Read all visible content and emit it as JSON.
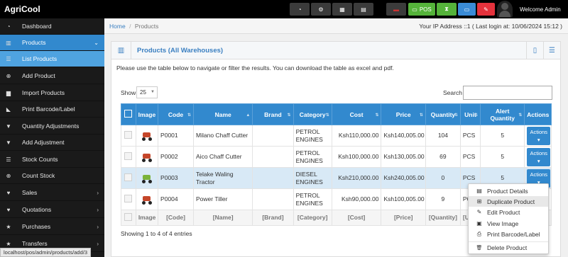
{
  "app": {
    "brand": "AgriCool"
  },
  "topbar": {
    "buttons": [
      {
        "icon": "dashboard-icon",
        "glyph": "◔"
      },
      {
        "icon": "settings-icon",
        "glyph": "⚙"
      },
      {
        "icon": "calculator-icon",
        "glyph": "▦"
      },
      {
        "icon": "calendar-icon",
        "glyph": "▤"
      },
      {
        "icon": "flag-icon",
        "glyph": "▬"
      },
      {
        "icon": "pos-icon",
        "glyph": "▭",
        "label": "POS"
      },
      {
        "icon": "hourglass-icon",
        "glyph": "⧗"
      },
      {
        "icon": "notes-icon",
        "glyph": "▭"
      },
      {
        "icon": "eraser-icon",
        "glyph": "✎"
      }
    ],
    "welcome": "Welcome Admin",
    "colors": {
      "green": "#55b33a",
      "blue": "#3a8bd6",
      "red": "#e5323c"
    }
  },
  "sidebar": {
    "items": [
      {
        "label": "Dashboard",
        "icon": "dashboard-icon",
        "glyph": "◔"
      },
      {
        "label": "Products",
        "icon": "barcode-icon",
        "glyph": "▥",
        "arrow": "⌄",
        "state": "active"
      },
      {
        "label": "List Products",
        "icon": "list-icon",
        "glyph": "☰",
        "state": "sub-active"
      },
      {
        "label": "Add Product",
        "icon": "plus-circle-icon",
        "glyph": "⊕"
      },
      {
        "label": "Import Products",
        "icon": "file-icon",
        "glyph": "▆"
      },
      {
        "label": "Print Barcode/Label",
        "icon": "tag-icon",
        "glyph": "◣"
      },
      {
        "label": "Quantity Adjustments",
        "icon": "filter-icon",
        "glyph": "▼"
      },
      {
        "label": "Add Adjustment",
        "icon": "filter-icon",
        "glyph": "▼"
      },
      {
        "label": "Stock Counts",
        "icon": "list-icon",
        "glyph": "☰"
      },
      {
        "label": "Count Stock",
        "icon": "plus-circle-icon",
        "glyph": "⊕"
      },
      {
        "label": "Sales",
        "icon": "heart-icon",
        "glyph": "♥",
        "arrow": "›"
      },
      {
        "label": "Quotations",
        "icon": "heart-icon",
        "glyph": "♥",
        "arrow": "›"
      },
      {
        "label": "Purchases",
        "icon": "star-icon",
        "glyph": "★",
        "arrow": "›"
      },
      {
        "label": "Transfers",
        "icon": "star-icon",
        "glyph": "★",
        "arrow": "›"
      }
    ],
    "colors": {
      "active": "#3289ce",
      "sub_active": "#4fa3e0"
    }
  },
  "breadcrumb": {
    "home": "Home",
    "separator": "/",
    "current": "Products"
  },
  "ip_info": "Your IP Address ::1 ( Last login at: 10/06/2024 15:12 )",
  "panel": {
    "title": "Products (All Warehouses)",
    "intro": "Please use the table below to navigate or filter the results. You can download the table as excel and pdf.",
    "show_label": "Show",
    "show_value": "25",
    "search_label": "Search",
    "search_value": ""
  },
  "table": {
    "columns": [
      "Image",
      "Code",
      "Name",
      "Brand",
      "Category",
      "Cost",
      "Price",
      "Quantity",
      "Unit",
      "Alert Quantity",
      "Actions"
    ],
    "rows": [
      {
        "code": "P0001",
        "name": "Milano Chaff Cutter",
        "brand": "",
        "category": "PETROL ENGINES",
        "cost": "Ksh110,000.00",
        "price": "Ksh140,005.00",
        "quantity": "104",
        "unit": "PCS",
        "alert": "5",
        "action": "Actions"
      },
      {
        "code": "P0002",
        "name": "Aico Chaff Cutter",
        "brand": "",
        "category": "PETROL ENGINES",
        "cost": "Ksh100,000.00",
        "price": "Ksh130,005.00",
        "quantity": "69",
        "unit": "PCS",
        "alert": "5",
        "action": "Actions"
      },
      {
        "code": "P0003",
        "name": "Telake Waling Tractor",
        "brand": "",
        "category": "DIESEL ENGINES",
        "cost": "Ksh210,000.00",
        "price": "Ksh240,005.00",
        "quantity": "0",
        "unit": "PCS",
        "alert": "5",
        "action": "Actions"
      },
      {
        "code": "P0004",
        "name": "Power Tiller",
        "brand": "",
        "category": "PETROL ENGINES",
        "cost": "Ksh90,000.00",
        "price": "Ksh100,005.00",
        "quantity": "9",
        "unit": "PCS",
        "alert": "",
        "action": ""
      }
    ],
    "footer": [
      "Image",
      "[Code]",
      "[Name]",
      "[Brand]",
      "[Category]",
      "[Cost]",
      "[Price]",
      "[Quantity]",
      "[Unit]",
      "",
      ""
    ],
    "info": "Showing 1 to 4 of 4 entries",
    "colors": {
      "header": "#3289ce",
      "highlight_row": "#d8e9f6"
    }
  },
  "actions_menu": {
    "items": [
      {
        "label": "Product Details",
        "icon": "file-icon",
        "glyph": "▤"
      },
      {
        "label": "Duplicate Product",
        "icon": "plus-square-icon",
        "glyph": "⊞",
        "state": "hover"
      },
      {
        "label": "Edit Product",
        "icon": "edit-icon",
        "glyph": "✎"
      },
      {
        "label": "View Image",
        "icon": "image-icon",
        "glyph": "▣"
      },
      {
        "label": "Print Barcode/Label",
        "icon": "print-icon",
        "glyph": "⎙"
      },
      {
        "label": "Delete Product",
        "icon": "trash-icon",
        "glyph": "🗑"
      }
    ]
  },
  "status_url": "localhost/pos/admin/products/add/3"
}
